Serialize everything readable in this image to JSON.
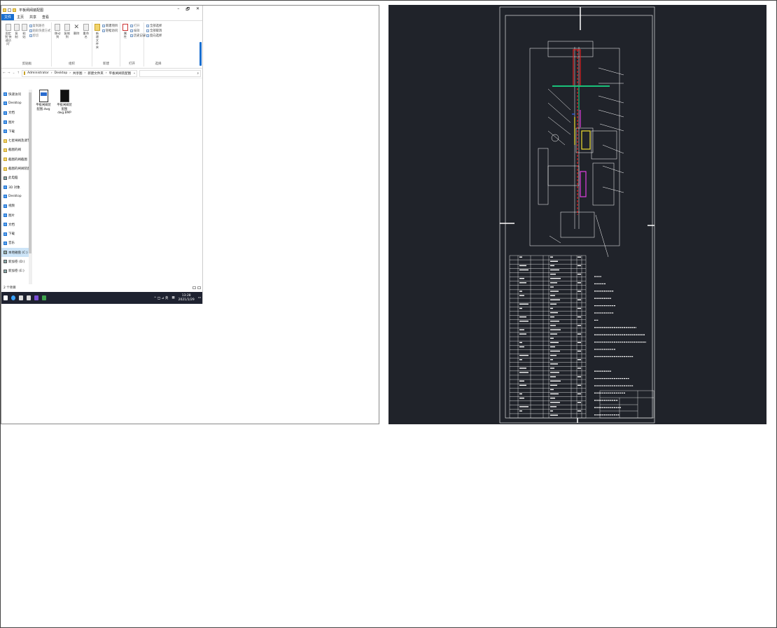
{
  "explorer": {
    "window_title": "平板闸阀装配图",
    "window_controls": [
      "–",
      "🗗",
      "✕"
    ],
    "tabs": [
      "文件",
      "主页",
      "共享",
      "查看"
    ],
    "ribbon": {
      "clipboard": {
        "label": "剪贴板",
        "pin_label": "固定到'快速访问'",
        "copy_label": "复制",
        "paste_label": "粘贴",
        "cut_label": "剪切",
        "copy_path_label": "复制路径",
        "paste_shortcut_label": "粘贴快捷方式"
      },
      "organize": {
        "label": "组织",
        "move_to_label": "移动到",
        "copy_to_label": "复制到",
        "delete_label": "删除",
        "rename_label": "重命名"
      },
      "new": {
        "label": "新建",
        "new_folder_label": "新建文件夹",
        "new_item_label": "新建项目",
        "easy_access_label": "轻松访问"
      },
      "open": {
        "label": "打开",
        "properties_label": "属性",
        "open_label": "打开",
        "edit_label": "编辑",
        "history_label": "历史记录"
      },
      "select": {
        "label": "选择",
        "select_all_label": "全部选择",
        "select_none_label": "全部取消",
        "invert_label": "反向选择"
      }
    },
    "breadcrumb": [
      "Administrator",
      "Desktop",
      "共享图",
      "新建文件夹",
      "平板闸阀装配图"
    ],
    "search_icon": "search-icon",
    "nav_items": [
      {
        "label": "快速访问",
        "type": "star"
      },
      {
        "label": "Desktop",
        "type": "folder-blue"
      },
      {
        "label": "文档",
        "type": "folder-blue"
      },
      {
        "label": "图片",
        "type": "folder-blue"
      },
      {
        "label": "下载",
        "type": "download"
      },
      {
        "label": "七星闸阀及调节阀",
        "type": "folder"
      },
      {
        "label": "截图的阀",
        "type": "folder"
      },
      {
        "label": "截图的阀截图",
        "type": "folder"
      },
      {
        "label": "截图的闸阀装配",
        "type": "folder"
      },
      {
        "label": "此电脑",
        "type": "pc"
      },
      {
        "label": "3D 对象",
        "type": "folder-blue"
      },
      {
        "label": "Desktop",
        "type": "folder-blue"
      },
      {
        "label": "视频",
        "type": "folder-blue"
      },
      {
        "label": "图片",
        "type": "folder-blue"
      },
      {
        "label": "文档",
        "type": "folder-blue"
      },
      {
        "label": "下载",
        "type": "download"
      },
      {
        "label": "音乐",
        "type": "folder-blue"
      },
      {
        "label": "本地磁盘 (C:)",
        "type": "drive",
        "selected": true
      },
      {
        "label": "新加卷 (D:)",
        "type": "drive"
      },
      {
        "label": "新加卷 (E:)",
        "type": "drive"
      }
    ],
    "files": [
      {
        "name": "平板闸阀装配图.dwg",
        "kind": "dwg"
      },
      {
        "name": "平板闸阀装配图dwg.BMP",
        "kind": "bmp"
      }
    ],
    "status": "2 个项目",
    "taskbar": {
      "tray_text": "^ 🖵 ⊿ 英",
      "time": "13:28",
      "date": "2021/1/29"
    }
  },
  "cad_drawing": {
    "background": "#20232a",
    "line_color": "#ffffff",
    "accent_colors": {
      "red": "#e02020",
      "green": "#19c27a",
      "yellow": "#f0e030",
      "magenta": "#e040e0",
      "blue": "#3060ff"
    }
  }
}
